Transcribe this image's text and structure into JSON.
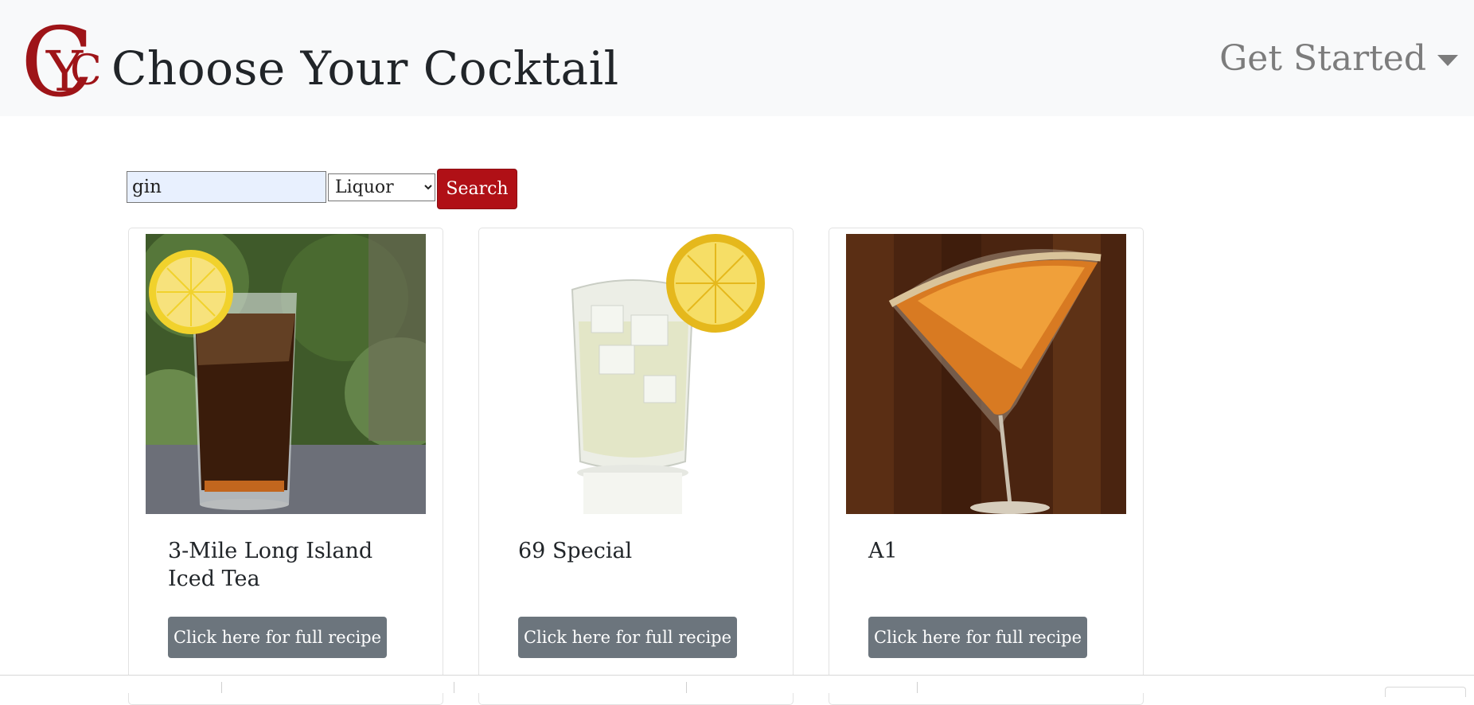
{
  "brand": {
    "logo_letters": "CYC",
    "title": "Choose Your Cocktail",
    "accent": "#b01016"
  },
  "nav": {
    "get_started": "Get Started",
    "caret_icon": "caret-down-icon"
  },
  "search": {
    "query": "gin",
    "filter_selected": "Liquor",
    "button_label": "Search"
  },
  "cards": [
    {
      "name": "3-Mile Long Island Iced Tea",
      "button_label": "Click here for full recipe",
      "image": "iced-tea-glass-with-lemon"
    },
    {
      "name": "69 Special",
      "button_label": "Click here for full recipe",
      "image": "lowball-glass-with-lemon"
    },
    {
      "name": "A1",
      "button_label": "Click here for full recipe",
      "image": "martini-glass-sugar-rim"
    }
  ]
}
